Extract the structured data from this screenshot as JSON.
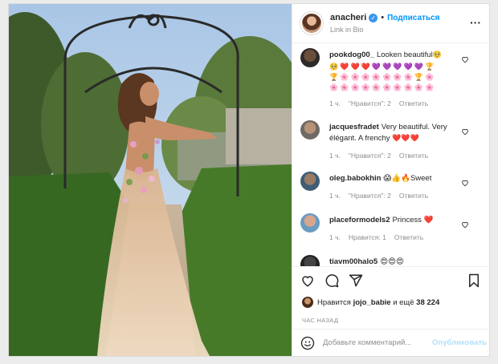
{
  "header": {
    "username": "anacheri",
    "follow_label": "Подписаться",
    "bio": "Link in Bio",
    "dot": "•"
  },
  "comments": [
    {
      "username": "pookdog00_",
      "text": "Looken beautiful",
      "time": "1 ч.",
      "likes": "\"Нравится\": 2",
      "reply": "Ответить",
      "emoji_rows": [
        [
          "🥺",
          "❤️",
          "❤️",
          "❤️",
          "💜",
          "💜",
          "💜",
          "💜",
          "💜",
          "🏆"
        ],
        [
          "🏆",
          "🌸",
          "🌸",
          "🌸",
          "🌸",
          "🌸",
          "🌸",
          "🌸",
          "🏆",
          "🌸"
        ],
        [
          "🌸",
          "🌸",
          "🌸",
          "🌸",
          "🌸",
          "🌸",
          "🌸",
          "🌸",
          "🌸",
          "🌸"
        ]
      ]
    },
    {
      "username": "jacquesfradet",
      "text": "Very beautiful. Very élégant. A frenchy",
      "time": "1 ч.",
      "likes": "\"Нравится\": 2",
      "reply": "Ответить"
    },
    {
      "username": "oleg.babokhin",
      "text": "😱👍🔥Sweet",
      "time": "1 ч.",
      "likes": "\"Нравится\": 2",
      "reply": "Ответить"
    },
    {
      "username": "placeformodels2",
      "text": "Princess ❤️",
      "time": "1 ч.",
      "likes": "Нравится: 1",
      "reply": "Ответить"
    },
    {
      "username": "tiavm00halo5",
      "text": "😍😍😍"
    }
  ],
  "likes": {
    "prefix": "Нравится",
    "user": "jojo_babie",
    "mid": "и ещё",
    "count": "38 224"
  },
  "time_ago": "ЧАС НАЗАД",
  "add_comment": {
    "placeholder": "Добавьте комментарий...",
    "post_label": "Опубликовать"
  },
  "icons": {
    "like": "heart-icon",
    "comment": "comment-icon",
    "share": "paper-plane-icon",
    "save": "bookmark-icon",
    "emoji": "smiley-icon",
    "more": "more-dots-icon"
  },
  "colors": {
    "accent": "#0095f6",
    "verified": "#3897f0",
    "muted": "#8e8e8e",
    "heart": "#ed4956"
  }
}
